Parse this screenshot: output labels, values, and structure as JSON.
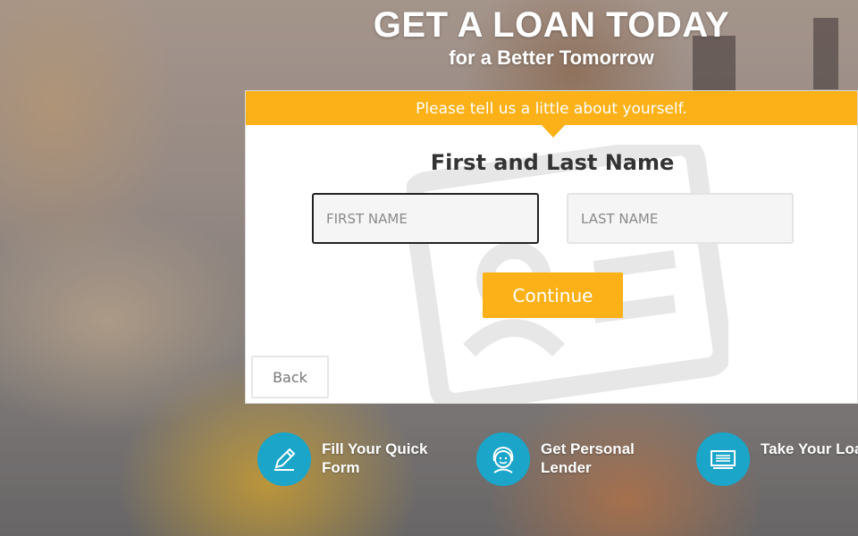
{
  "hero": {
    "title": "GET A LOAN TODAY",
    "subtitle": "for a Better Tomorrow"
  },
  "form": {
    "banner": "Please tell us a little about yourself.",
    "heading": "First and Last Name",
    "first_name_placeholder": "FIRST NAME",
    "last_name_placeholder": "LAST NAME",
    "continue_label": "Continue",
    "back_label": "Back"
  },
  "steps": [
    {
      "label": "Fill Your Quick Form",
      "icon": "pencil-icon"
    },
    {
      "label": "Get Personal Lender",
      "icon": "person-icon"
    },
    {
      "label": "Take Your Loan!",
      "icon": "cash-icon"
    }
  ],
  "colors": {
    "accent": "#fbb117",
    "step_circle": "#1aa5c9"
  }
}
